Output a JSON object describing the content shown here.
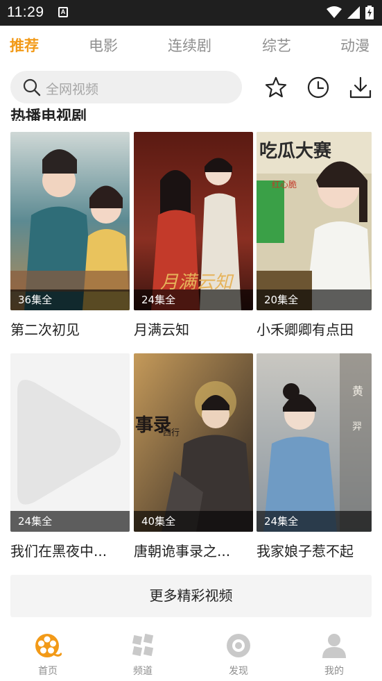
{
  "status_bar": {
    "time": "11:29",
    "notification_badge": "A",
    "icons": [
      "wifi-icon",
      "signal-icon",
      "battery-charging-icon"
    ]
  },
  "tabs": [
    {
      "label": "推荐",
      "active": true
    },
    {
      "label": "电影",
      "active": false
    },
    {
      "label": "连续剧",
      "active": false
    },
    {
      "label": "综艺",
      "active": false
    },
    {
      "label": "动漫",
      "active": false
    }
  ],
  "search": {
    "placeholder": "全网视频"
  },
  "toolbar_icons": [
    "star-icon",
    "history-clock-icon",
    "download-icon"
  ],
  "section": {
    "title": "热播电视剧"
  },
  "videos": [
    {
      "title": "第二次初见",
      "episodes": "36集全",
      "palette": "#4e7a86"
    },
    {
      "title": "月满云知",
      "episodes": "24集全",
      "palette": "#6b1f1b"
    },
    {
      "title": "小禾卿卿有点田",
      "episodes": "20集全",
      "palette": "#cfc6a9"
    },
    {
      "title": "我们在黑夜中...",
      "episodes": "24集全",
      "palette": "#f2f2f2"
    },
    {
      "title": "唐朝诡事录之...",
      "episodes": "40集全",
      "palette": "#3a3330"
    },
    {
      "title": "我家娘子惹不起",
      "episodes": "24集全",
      "palette": "#9aa9b3"
    }
  ],
  "more_button": {
    "label": "更多精彩视频"
  },
  "bottom_nav": [
    {
      "label": "首页",
      "icon": "film-reel-icon",
      "active": true
    },
    {
      "label": "频道",
      "icon": "channel-icon",
      "active": false
    },
    {
      "label": "发现",
      "icon": "discover-icon",
      "active": false
    },
    {
      "label": "我的",
      "icon": "profile-icon",
      "active": false
    }
  ],
  "colors": {
    "accent": "#f29a18",
    "tab_inactive": "#8f8f8f",
    "status_bar": "#1f1f1f",
    "search_bg": "#efefef",
    "nav_inactive": "#c9c9c9"
  }
}
